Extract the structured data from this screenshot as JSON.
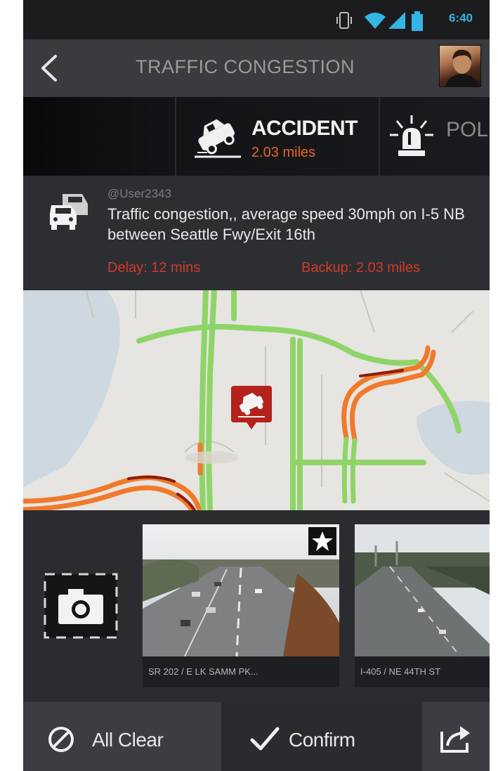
{
  "status_bar": {
    "time": "6:40",
    "icons": [
      "vibrate-icon",
      "wifi-icon",
      "signal-icon",
      "battery-icon"
    ],
    "accent_color": "#33b5e5"
  },
  "header": {
    "title": "TRAFFIC CONGESTION",
    "back_icon": "chevron-left-icon",
    "avatar": "user-avatar"
  },
  "categories": [
    {
      "label": "ACCIDENT",
      "distance": "2.03 miles",
      "icon": "accident-car-icon",
      "selected": true
    },
    {
      "label": "POL",
      "icon": "police-light-icon",
      "selected": false
    }
  ],
  "incident": {
    "icon": "traffic-cars-icon",
    "user": "@User2343",
    "description": "Traffic congestion,, average speed 30mph on I-5 NB between Seattle Fwy/Exit 16th",
    "delay": "Delay: 12 mins",
    "backup": "Backup: 2.03 miles"
  },
  "map": {
    "marker_icon": "accident-marker-icon",
    "colors": {
      "clear": "#8fd468",
      "slow": "#f07a2b",
      "heavy": "#8a1c12",
      "water": "#cdd8e0",
      "land": "#e7e5e1"
    }
  },
  "cameras": {
    "add_icon": "camera-add-icon",
    "items": [
      {
        "caption": "SR 202 / E LK SAMM PK...",
        "favorite": true
      },
      {
        "caption": "I-405 / NE 44TH ST",
        "favorite": false
      }
    ]
  },
  "actions": {
    "all_clear": {
      "label": "All Clear",
      "icon": "prohibit-icon"
    },
    "confirm": {
      "label": "Confirm",
      "icon": "checkmark-icon"
    },
    "share": {
      "icon": "share-icon"
    }
  }
}
